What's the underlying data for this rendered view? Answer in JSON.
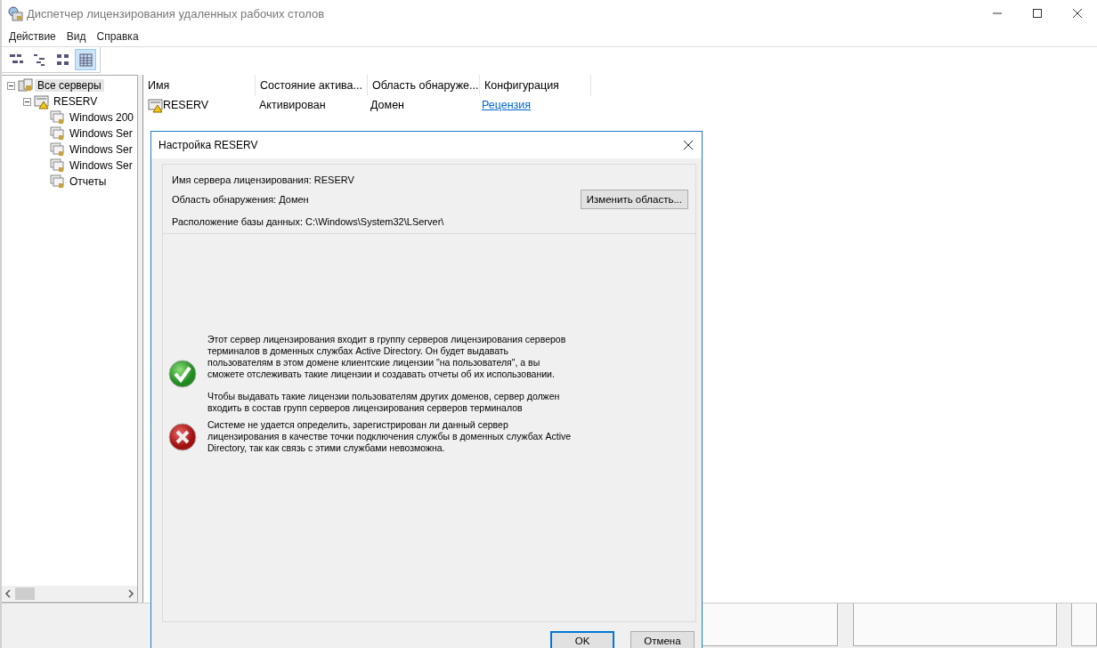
{
  "window": {
    "title": "Диспетчер лицензирования удаленных рабочих столов"
  },
  "menu": [
    "Действие",
    "Вид",
    "Справка"
  ],
  "toolbar": [
    {
      "kind": "tree-view",
      "selected": false
    },
    {
      "kind": "outline-view",
      "selected": false
    },
    {
      "kind": "grid-view",
      "selected": false
    },
    {
      "kind": "detail-view",
      "selected": true
    }
  ],
  "tree": [
    {
      "label": "Все серверы",
      "kind": "servers",
      "selected": true,
      "expanded": true,
      "children": [
        {
          "label": "RESERV",
          "kind": "server-warning",
          "selected": false,
          "expanded": true,
          "children": [
            {
              "label": "Windows 200",
              "kind": "licenses",
              "selected": false
            },
            {
              "label": "Windows Ser",
              "kind": "licenses",
              "selected": false
            },
            {
              "label": "Windows Ser",
              "kind": "licenses",
              "selected": false
            },
            {
              "label": "Windows Ser",
              "kind": "licenses",
              "selected": false
            },
            {
              "label": "Отчеты",
              "kind": "licenses",
              "selected": false
            }
          ]
        }
      ]
    }
  ],
  "list": {
    "columns": [
      "Имя",
      "Состояние актива...",
      "Область обнаруже...",
      "Конфигурация"
    ],
    "rows": [
      {
        "name": "RESERV",
        "status": "Активирован",
        "scope": "Домен",
        "configuration": "Рецензия"
      }
    ]
  },
  "dialog": {
    "title": "Настройка RESERV",
    "info": [
      "Имя сервера лицензирования: RESERV",
      "Область обнаружения: Домен",
      "Расположение базы данных: C:\\Windows\\System32\\LServer\\"
    ],
    "change_scope_button": "Изменить область...",
    "messages": [
      {
        "kind": "ok",
        "paragraphs": [
          "Этот сервер лицензирования входит в группу серверов лицензирования серверов терминалов в доменных службах Active Directory. Он будет выдавать пользователям в этом домене клиентские лицензии \"на пользователя\", а вы сможете отслеживать такие лицензии и создавать отчеты об их использовании.",
          "Чтобы выдавать такие лицензии пользователям других доменов, сервер должен входить в состав групп серверов лицензирования серверов терминалов"
        ]
      },
      {
        "kind": "error",
        "paragraphs": [
          "Системе не удается определить, зарегистрирован ли данный сервер лицензирования в качестве точки подключения службы в доменных службах Active Directory, так как связь с этими службами невозможна."
        ]
      }
    ],
    "buttons": [
      {
        "label": "OK",
        "default": true
      },
      {
        "label": "Отмена",
        "default": false
      }
    ]
  }
}
